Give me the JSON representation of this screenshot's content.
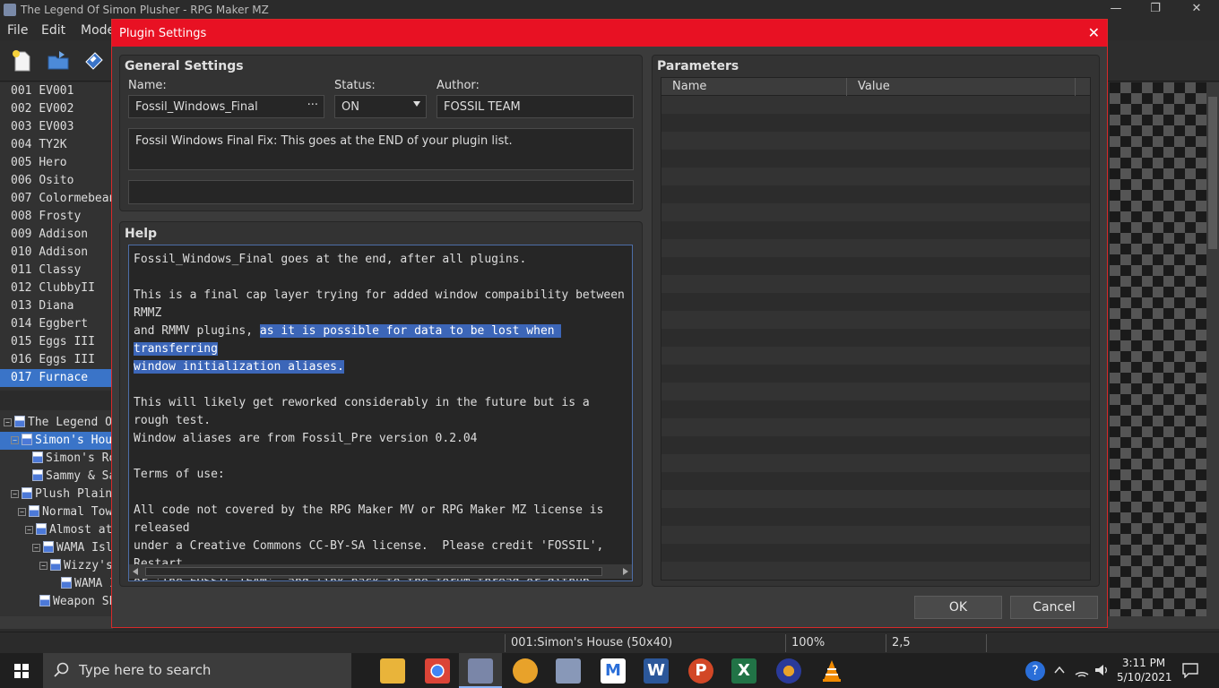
{
  "window": {
    "title": "The Legend Of Simon Plusher - RPG Maker MZ",
    "controls": [
      "—",
      "❐",
      "✕"
    ]
  },
  "menu": [
    "File",
    "Edit",
    "Mode"
  ],
  "events": [
    {
      "id": "001",
      "name": "EV001"
    },
    {
      "id": "002",
      "name": "EV002"
    },
    {
      "id": "003",
      "name": "EV003"
    },
    {
      "id": "004",
      "name": "TY2K"
    },
    {
      "id": "005",
      "name": "Hero"
    },
    {
      "id": "006",
      "name": "Osito"
    },
    {
      "id": "007",
      "name": "Colormebeani"
    },
    {
      "id": "008",
      "name": "Frosty"
    },
    {
      "id": "009",
      "name": "Addison"
    },
    {
      "id": "010",
      "name": "Addison"
    },
    {
      "id": "011",
      "name": "Classy"
    },
    {
      "id": "012",
      "name": "ClubbyII"
    },
    {
      "id": "013",
      "name": "Diana"
    },
    {
      "id": "014",
      "name": "Eggbert"
    },
    {
      "id": "015",
      "name": "Eggs III"
    },
    {
      "id": "016",
      "name": "Eggs III"
    },
    {
      "id": "017",
      "name": "Furnace"
    }
  ],
  "selected_event": "017",
  "map_tree": [
    {
      "label": "The Legend O",
      "toggle": "−"
    },
    {
      "label": "Simon's Hou",
      "toggle": "−"
    },
    {
      "label": "Simon's Ro",
      "toggle": ""
    },
    {
      "label": "Sammy & Sa",
      "toggle": ""
    },
    {
      "label": "Plush Plain",
      "toggle": "−"
    },
    {
      "label": "Normal Tow",
      "toggle": "−"
    },
    {
      "label": "Almost at",
      "toggle": "−"
    },
    {
      "label": "WAMA Isl",
      "toggle": "−"
    },
    {
      "label": "Wizzy's",
      "toggle": "−"
    },
    {
      "label": "WAMA I",
      "toggle": ""
    },
    {
      "label": "Weapon Sh",
      "toggle": ""
    }
  ],
  "status": {
    "map": "001:Simon's House (50x40)",
    "zoom": "100%",
    "coords": "2,5"
  },
  "taskbar": {
    "search_placeholder": "Type here to search",
    "time": "3:11 PM",
    "date": "5/10/2021"
  },
  "dialog": {
    "title": "Plugin Settings",
    "close": "✕",
    "general": {
      "title": "General Settings",
      "name_label": "Name:",
      "name_value": "Fossil_Windows_Final",
      "ellipsis": "···",
      "status_label": "Status:",
      "status_value": "ON",
      "author_label": "Author:",
      "author_value": "FOSSIL TEAM",
      "description": "Fossil Windows Final Fix: This goes at the END of your plugin list.",
      "url": ""
    },
    "help": {
      "title": "Help",
      "line1": "Fossil_Windows_Final goes at the end, after all plugins.",
      "p2_a": "This is a final cap layer trying for added window compaibility between RMMZ\nand RMMV plugins, ",
      "p2_hl": "as it is possible for data to be lost when transferring\nwindow initialization aliases.",
      "p3": "This will likely get reworked considerably in the future but is a rough test.\nWindow aliases are from Fossil_Pre version 0.2.04",
      "p4": "Terms of use:",
      "p5": "All code not covered by the RPG Maker MV or RPG Maker MZ license is released\nunder a Creative Commons CC-BY-SA license.  Please credit 'FOSSIL', Restart,\nor 'The FOSSIL TEAM', and link back to the forum thread or github."
    },
    "parameters": {
      "title": "Parameters",
      "col_name": "Name",
      "col_value": "Value"
    },
    "ok": "OK",
    "cancel": "Cancel"
  },
  "colors": {
    "dialog_titlebar": "#e81123",
    "selection": "#3a74c8",
    "text_highlight": "#3c66b8"
  }
}
